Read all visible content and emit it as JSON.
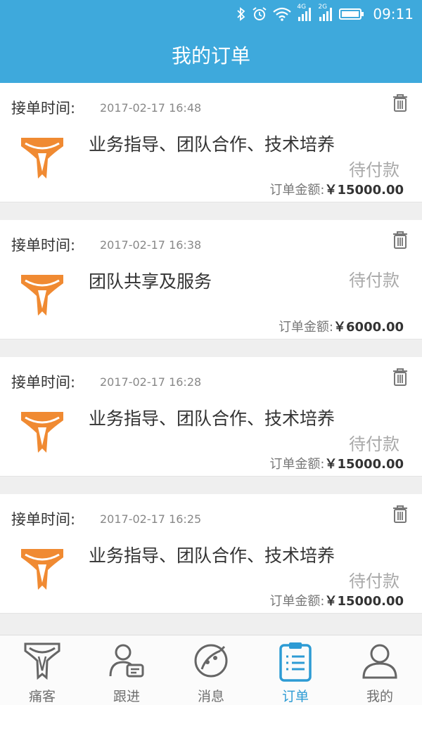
{
  "status_bar": {
    "network_4g": "4G",
    "network_2g": "2G",
    "time": "09:11"
  },
  "header": {
    "title": "我的订单"
  },
  "orders": [
    {
      "label": "接单时间:",
      "time": "2017-02-17 16:48",
      "name": "业务指导、团队合作、技术培养",
      "status": "待付款",
      "amount_label": "订单金额:",
      "amount": "￥15000.00"
    },
    {
      "label": "接单时间:",
      "time": "2017-02-17 16:38",
      "name": "团队共享及服务",
      "status": "待付款",
      "amount_label": "订单金额:",
      "amount": "￥6000.00"
    },
    {
      "label": "接单时间:",
      "time": "2017-02-17 16:28",
      "name": "业务指导、团队合作、技术培养",
      "status": "待付款",
      "amount_label": "订单金额:",
      "amount": "￥15000.00"
    },
    {
      "label": "接单时间:",
      "time": "2017-02-17 16:25",
      "name": "业务指导、团队合作、技术培养",
      "status": "待付款",
      "amount_label": "订单金额:",
      "amount": "￥15000.00"
    }
  ],
  "tabs": [
    {
      "label": "痛客",
      "icon": "brand-logo-icon",
      "active": false
    },
    {
      "label": "跟进",
      "icon": "contact-card-icon",
      "active": false
    },
    {
      "label": "消息",
      "icon": "message-icon",
      "active": false
    },
    {
      "label": "订单",
      "icon": "clipboard-icon",
      "active": true
    },
    {
      "label": "我的",
      "icon": "person-icon",
      "active": false
    }
  ],
  "colors": {
    "header_bg": "#3ea9dc",
    "brand_orange": "#f08a32",
    "tab_active": "#2d9bd4",
    "status_gray": "#a9a9a9"
  }
}
